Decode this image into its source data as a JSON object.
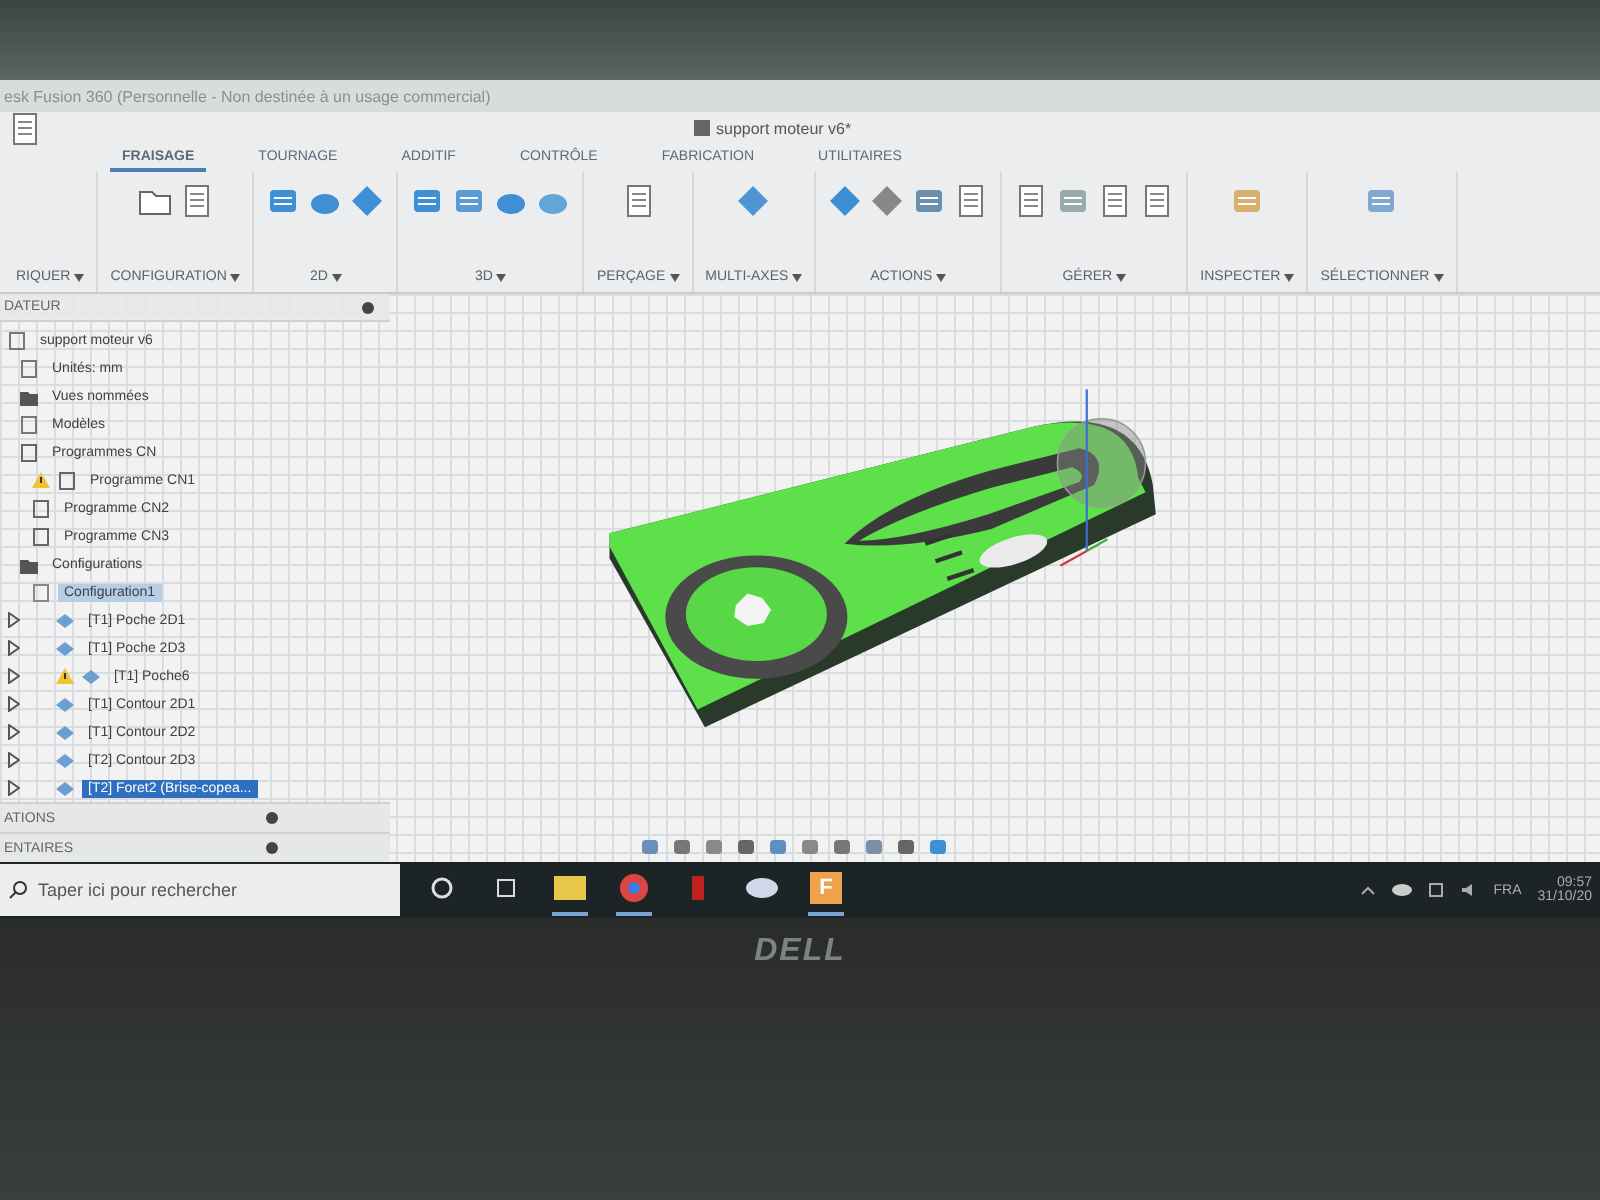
{
  "window": {
    "title": "esk Fusion 360 (Personnelle - Non destinée à un usage commercial)"
  },
  "document_tab": {
    "title": "support moteur v6*"
  },
  "tabs": [
    {
      "label": "FRAISAGE",
      "selected": true
    },
    {
      "label": "TOURNAGE",
      "selected": false
    },
    {
      "label": "ADDITIF",
      "selected": false
    },
    {
      "label": "CONTRÔLE",
      "selected": false
    },
    {
      "label": "FABRICATION",
      "selected": false
    },
    {
      "label": "UTILITAIRES",
      "selected": false
    }
  ],
  "toolbar_groups": [
    {
      "label": "RIQUER"
    },
    {
      "label": "CONFIGURATION"
    },
    {
      "label": "2D"
    },
    {
      "label": "3D"
    },
    {
      "label": "PERÇAGE"
    },
    {
      "label": "MULTI-AXES"
    },
    {
      "label": "ACTIONS"
    },
    {
      "label": "GÉRER"
    },
    {
      "label": "INSPECTER"
    },
    {
      "label": "SÉLECTIONNER"
    }
  ],
  "browser": {
    "title": "DATEUR",
    "items": [
      {
        "label": "support moteur v6",
        "kind": "document",
        "children": [
          {
            "label": "Unités: mm",
            "kind": "units"
          },
          {
            "label": "Vues nommées",
            "kind": "folder"
          },
          {
            "label": "Modèles",
            "kind": "models"
          },
          {
            "label": "Programmes CN",
            "kind": "programs",
            "children": [
              {
                "label": "Programme CN1",
                "kind": "program",
                "warning": true
              },
              {
                "label": "Programme CN2",
                "kind": "program",
                "warning": false
              },
              {
                "label": "Programme CN3",
                "kind": "program",
                "warning": false
              }
            ]
          },
          {
            "label": "Configurations",
            "kind": "folder",
            "children": [
              {
                "label": "Configuration1",
                "kind": "setup",
                "active": true,
                "children": [
                  {
                    "label": "[T1] Poche 2D1",
                    "kind": "operation",
                    "warning": false,
                    "selected": false
                  },
                  {
                    "label": "[T1] Poche 2D3",
                    "kind": "operation",
                    "warning": false,
                    "selected": false
                  },
                  {
                    "label": "[T1] Poche6",
                    "kind": "operation",
                    "warning": true,
                    "selected": false
                  },
                  {
                    "label": "[T1] Contour 2D1",
                    "kind": "operation",
                    "warning": false,
                    "selected": false
                  },
                  {
                    "label": "[T1] Contour 2D2",
                    "kind": "operation",
                    "warning": false,
                    "selected": false
                  },
                  {
                    "label": "[T2] Contour 2D3",
                    "kind": "operation",
                    "warning": false,
                    "selected": false
                  },
                  {
                    "label": "[T2] Foret2 (Brise-copea...",
                    "kind": "operation",
                    "warning": false,
                    "selected": true
                  }
                ]
              }
            ]
          }
        ]
      }
    ]
  },
  "bottom_panels": [
    {
      "label": "ATIONS"
    },
    {
      "label": "ENTAIRES"
    }
  ],
  "taskbar": {
    "search": {
      "placeholder": "Taper ici pour rechercher"
    },
    "apps": [
      {
        "kind": "cortana"
      },
      {
        "kind": "taskview"
      },
      {
        "kind": "explorer"
      },
      {
        "kind": "chrome"
      },
      {
        "kind": "red"
      },
      {
        "kind": "cloud"
      },
      {
        "kind": "fusion",
        "label": "F"
      }
    ],
    "language": "FRA",
    "time": "09:57",
    "date": "31/10/20"
  },
  "bezel": {
    "logo": "DELL"
  }
}
